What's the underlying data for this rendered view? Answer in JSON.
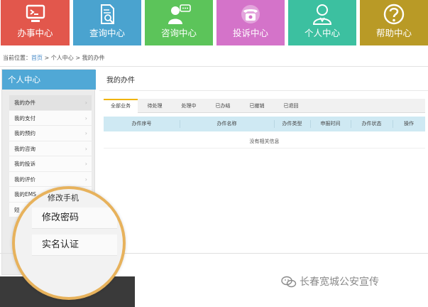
{
  "topnav": {
    "tiles": [
      {
        "label": "办事中心",
        "icon": "monitor-icon"
      },
      {
        "label": "查询中心",
        "icon": "document-search-icon"
      },
      {
        "label": "咨询中心",
        "icon": "user-chat-icon"
      },
      {
        "label": "投诉中心",
        "icon": "telephone-icon"
      },
      {
        "label": "个人中心",
        "icon": "person-icon"
      },
      {
        "label": "帮助中心",
        "icon": "question-icon"
      }
    ],
    "colors": [
      "#e2574c",
      "#4aa3cf",
      "#5cc45a",
      "#d473c9",
      "#3cc0a0",
      "#b99a26"
    ]
  },
  "breadcrumb": {
    "prefix": "当前位置：",
    "home": "首页",
    "sep": " > ",
    "section": "个人中心",
    "current": "我的办件"
  },
  "sidebar": {
    "title": "个人中心",
    "items": [
      {
        "label": "我的办件",
        "active": true
      },
      {
        "label": "我的支付"
      },
      {
        "label": "我的预约"
      },
      {
        "label": "我的咨询"
      },
      {
        "label": "我的投诉"
      },
      {
        "label": "我的评价"
      },
      {
        "label": "我的EMS"
      },
      {
        "label": "短"
      }
    ],
    "ems_overlap_text": "修改手机"
  },
  "main": {
    "title": "我的办件",
    "tabs": [
      "全部业务",
      "待处理",
      "处理中",
      "已办结",
      "已撤销",
      "已退回"
    ],
    "active_tab": 0,
    "columns": [
      "办件序号",
      "办件名称",
      "办件类型",
      "申报时间",
      "办件状态",
      "操作"
    ],
    "empty_text": "没有相关信息"
  },
  "magnifier": {
    "items": [
      "修改密码",
      "实名认证"
    ]
  },
  "watermark": {
    "text": "长春宽城公安宣传",
    "icon": "wechat-icon"
  }
}
